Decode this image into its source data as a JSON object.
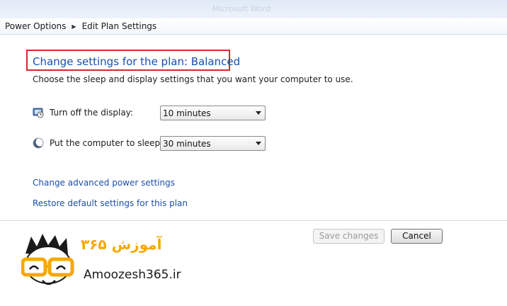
{
  "titlebar": {
    "ghost_text": "Microsoft Word"
  },
  "breadcrumb": {
    "items": [
      "Power Options",
      "Edit Plan Settings"
    ]
  },
  "page": {
    "title": "Change settings for the plan: Balanced",
    "subtitle": "Choose the sleep and display settings that you want your computer to use."
  },
  "settings": {
    "display": {
      "label": "Turn off the display:",
      "value": "10 minutes",
      "icon": "monitor-clock-icon"
    },
    "sleep": {
      "label": "Put the computer to sleep:",
      "value": "30 minutes",
      "icon": "moon-sleep-icon"
    }
  },
  "links": {
    "advanced": "Change advanced power settings",
    "restore": "Restore default settings for this plan"
  },
  "buttons": {
    "save": "Save changes",
    "cancel": "Cancel"
  },
  "watermark": {
    "persian": "آموزش ۳۶۵",
    "site": "Amoozesh365.ir"
  },
  "colors": {
    "link": "#1b4fa8",
    "highlight": "#d7282f",
    "brand": "#f6a800"
  }
}
